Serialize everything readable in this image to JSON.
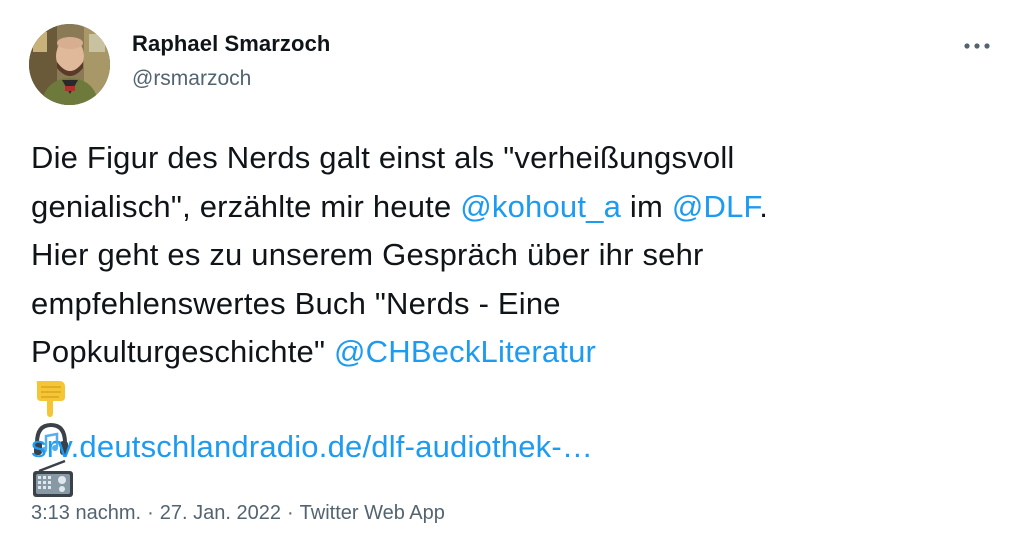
{
  "author": {
    "display_name": "Raphael Smarzoch",
    "handle": "@rsmarzoch"
  },
  "more_icon": "more-horizontal-icon",
  "tweet": {
    "line1": "Die Figur des Nerds galt einst als \"verheißungsvoll",
    "line2_prefix": "genialisch\", erzählte mir heute ",
    "mention_kohout": "@kohout_a",
    "line2_mid": " im ",
    "mention_dlf": "@DLF",
    "line2_suffix": ".",
    "line3": "Hier geht es zu unserem Gespräch über ihr sehr",
    "line4": "empfehlenswertes Buch \"Nerds - Eine",
    "line5_prefix": "Popkulturgeschichte\" ",
    "mention_chbeck": "@CHBeckLiteratur",
    "emojis": [
      "backhand-index-pointing-down-icon",
      "headphone-icon",
      "radio-icon"
    ],
    "link": "srv.deutschlandradio.de/dlf-audiothek-…"
  },
  "meta": {
    "time": "3:13 nachm.",
    "separator": "·",
    "date": "27. Jan. 2022",
    "source": "Twitter Web App"
  },
  "colors": {
    "link": "#1d9bf0",
    "secondary_text": "#536471",
    "primary_text": "#0f1419"
  }
}
